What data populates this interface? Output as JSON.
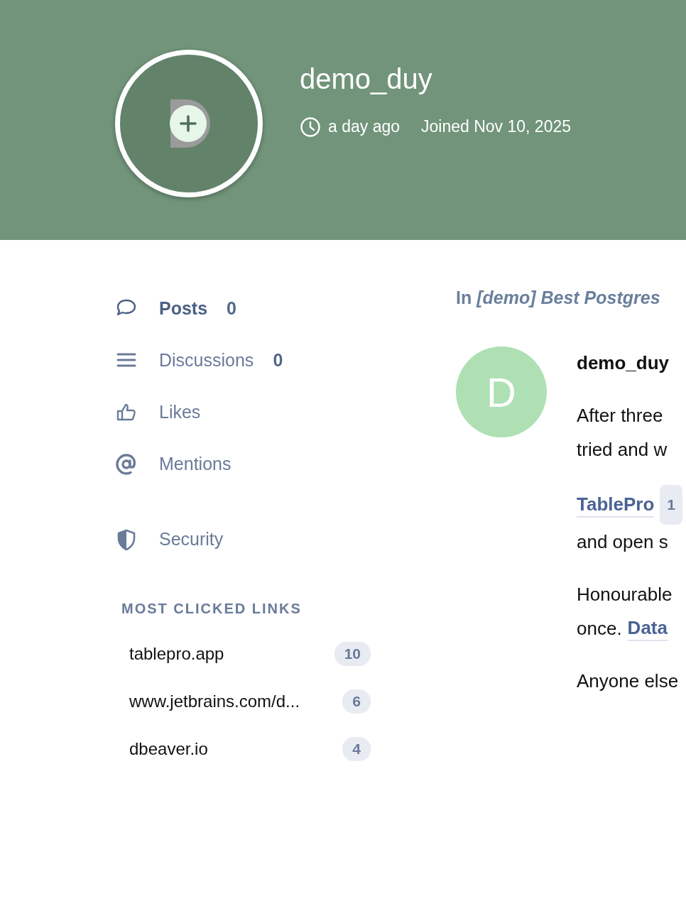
{
  "profile": {
    "username": "demo_duy",
    "last_seen": "a day ago",
    "joined": "Joined Nov 10, 2025"
  },
  "nav": [
    {
      "kind": "posts",
      "label": "Posts",
      "count": "0",
      "selected": true
    },
    {
      "kind": "discussions",
      "label": "Discussions",
      "count": "0",
      "selected": false
    },
    {
      "kind": "likes",
      "label": "Likes",
      "selected": false
    },
    {
      "kind": "mentions",
      "label": "Mentions",
      "selected": false
    },
    {
      "kind": "security",
      "label": "Security",
      "selected": false
    }
  ],
  "links_heading": "MOST CLICKED LINKS",
  "links": [
    {
      "url": "tablepro.app",
      "count": "10"
    },
    {
      "url": "www.jetbrains.com/d...",
      "count": "6"
    },
    {
      "url": "dbeaver.io",
      "count": "4"
    }
  ],
  "post": {
    "topic_prefix": "In",
    "topic": "[demo] Best Postgres",
    "avatar_letter": "D",
    "author": "demo_duy",
    "paragraphs": [
      {
        "lines": [
          {
            "text": "After three"
          },
          {
            "text": "tried and w"
          }
        ]
      },
      {
        "lines": [
          {
            "link": "TablePro",
            "badge": "1"
          },
          {
            "text": "and open s"
          }
        ]
      },
      {
        "lines": [
          {
            "text": "Honourable"
          },
          {
            "text": "once.",
            "link": "Data"
          }
        ]
      },
      {
        "lines": [
          {
            "text": "Anyone else"
          }
        ]
      }
    ]
  }
}
